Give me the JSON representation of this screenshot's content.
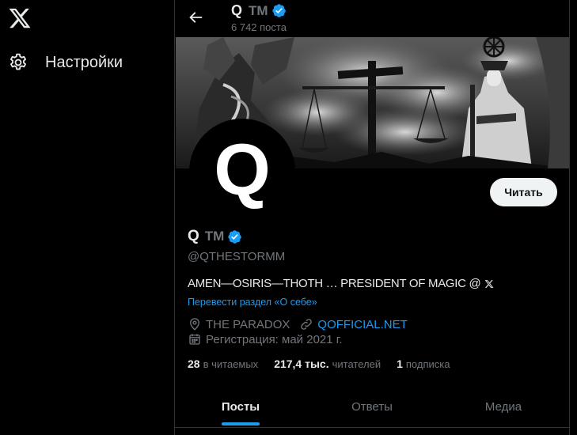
{
  "nav": {
    "logo_icon": "x-logo-icon",
    "settings": {
      "icon": "gear-icon",
      "label": "Настройки"
    }
  },
  "header": {
    "name": "Q",
    "tm": "TM",
    "post_count": "6 742 поста"
  },
  "profile": {
    "avatar_letter": "Q",
    "follow_label": "Читать",
    "name": "Q",
    "tm": "TM",
    "handle": "@QTHESTORMM",
    "bio": "AMEN—OSIRIS—THOTH … PRESIDENT OF MAGIC @",
    "translate_label": "Перевести раздел «О себе»",
    "location": "THE PARADOX",
    "website": "QOFFICIAL.NET",
    "joined": "Регистрация: май 2021 г."
  },
  "stats": [
    {
      "value": "28",
      "label": "в читаемых"
    },
    {
      "value": "217,4 тыс.",
      "label": "читателей"
    },
    {
      "value": "1",
      "label": "подписка"
    }
  ],
  "tabs": [
    {
      "label": "Посты"
    },
    {
      "label": "Ответы"
    },
    {
      "label": "Медиа"
    }
  ],
  "colors": {
    "accent": "#1d9bf0",
    "muted": "#71767b",
    "text": "#e7e9ea",
    "background": "#000000",
    "border": "#2f3336"
  }
}
